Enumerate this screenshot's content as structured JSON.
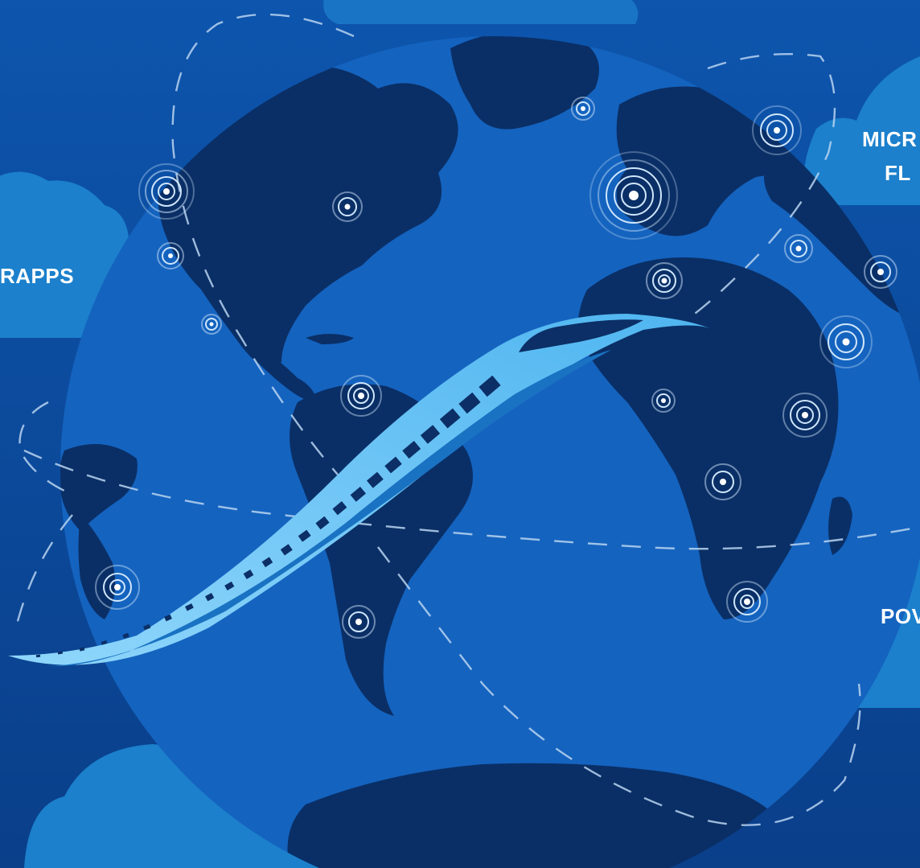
{
  "scene": {
    "background_color": "#0b4a9a",
    "globe_color": "#1565c0",
    "land_color": "#0a2f66",
    "cloud_color": "#1c7fcb",
    "train_color": "#5bc0f5",
    "dashed_route_color": "#b8d4f0"
  },
  "labels": {
    "left_cloud": "RAPPS",
    "right_cloud_line1": "MICR",
    "right_cloud_line2": "FL",
    "bottom_right_cloud": "POV"
  },
  "icons": {
    "location_marker": "location-pulse-icon",
    "train": "high-speed-train-icon",
    "cloud": "cloud-icon",
    "globe": "globe-icon"
  }
}
